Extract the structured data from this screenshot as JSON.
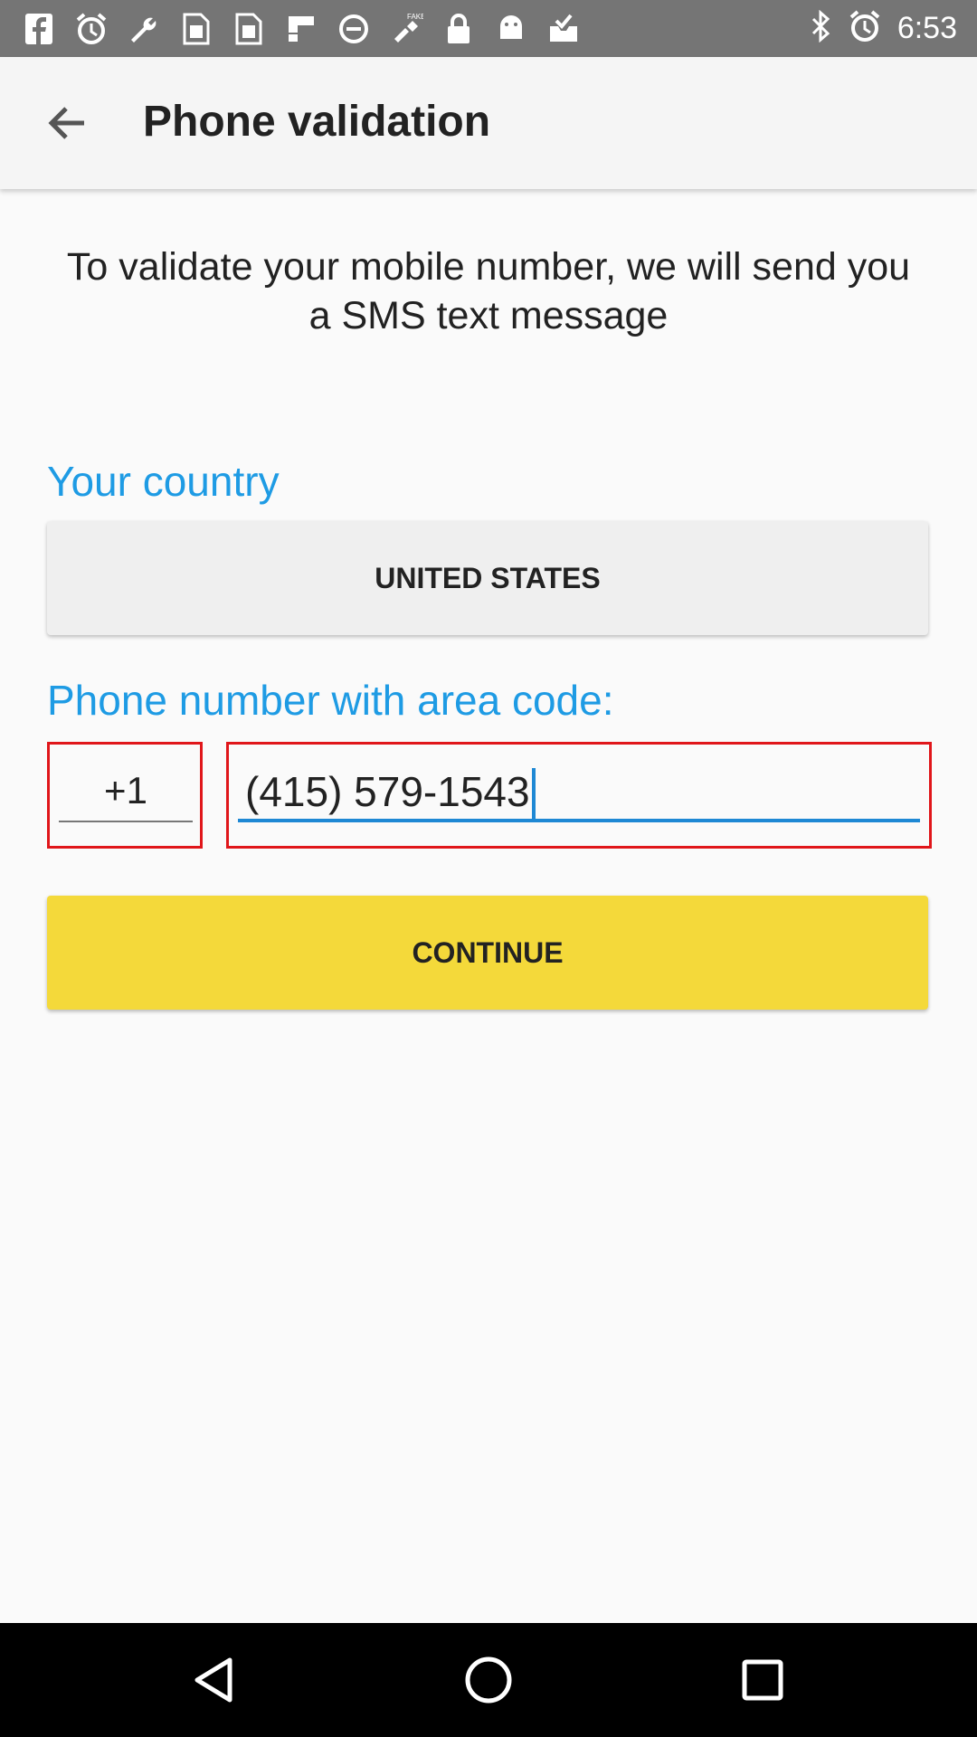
{
  "status_bar": {
    "time": "6:53",
    "icons": [
      "facebook-icon",
      "alarm-icon",
      "wrench-icon",
      "sim-icon",
      "sim-icon",
      "flipboard-icon",
      "no-disturb-icon",
      "fake-gps-icon",
      "lock-icon",
      "android-icon",
      "inbox-icon"
    ],
    "right_icons": [
      "bluetooth-icon",
      "alarm-icon"
    ]
  },
  "app_bar": {
    "title": "Phone validation"
  },
  "intro_text": "To validate your mobile number, we will send you a SMS text message",
  "country": {
    "label": "Your country",
    "value": "UNITED STATES"
  },
  "phone": {
    "label": "Phone number with area code:",
    "country_code": "+1",
    "number": "(415) 579-1543"
  },
  "continue_label": "CONTINUE",
  "colors": {
    "accent_blue": "#1e9be4",
    "button_yellow": "#f4d93a",
    "highlight_red": "#e0161a"
  }
}
